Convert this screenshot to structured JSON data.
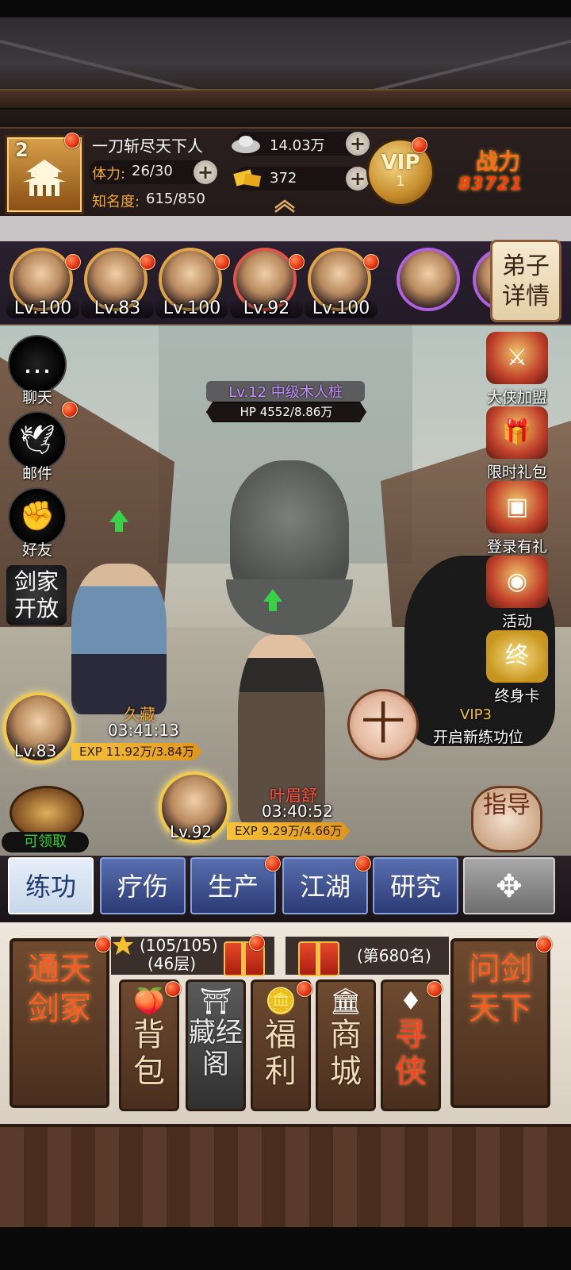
{
  "player": {
    "rank_level": "2",
    "name": "一刀斩尽天下人",
    "stamina_label": "体力:",
    "stamina_value": "26/30",
    "fame_label": "知名度:",
    "fame_value": "615/850",
    "silver": "14.03万",
    "gold": "372",
    "vip_text": "VIP",
    "vip_level": "1",
    "power_label": "战力",
    "power_value": "83721"
  },
  "disciples": [
    {
      "level": "Lv.100"
    },
    {
      "level": "Lv.83"
    },
    {
      "level": "Lv.100"
    },
    {
      "level": "Lv.92"
    },
    {
      "level": "Lv.100"
    }
  ],
  "disciple_detail_label": "弟子详情",
  "enemy": {
    "name": "Lv.12 中级木人桩",
    "hp": "HP 4552/8.86万"
  },
  "left_menu": [
    {
      "label": "聊天",
      "icon": "chat-bubble-icon"
    },
    {
      "label": "邮件",
      "icon": "dove-mail-icon"
    },
    {
      "label": "好友",
      "icon": "friends-fist-icon"
    }
  ],
  "jianjia_label": "剑家开放",
  "right_menu": [
    {
      "label": "大侠加盟",
      "icon": "hero-join-icon"
    },
    {
      "label": "限时礼包",
      "icon": "gift-pack-icon"
    },
    {
      "label": "登录有礼",
      "icon": "treasure-chest-icon"
    },
    {
      "label": "活动",
      "icon": "lantern-icon"
    },
    {
      "label": "终身卡",
      "icon": "lifetime-card-icon"
    }
  ],
  "cultivators": [
    {
      "name": "久藏",
      "timer": "03:41:13",
      "level": "Lv.83",
      "exp": "EXP 11.92万/3.84万"
    },
    {
      "name": "叶眉舒",
      "timer": "03:40:52",
      "level": "Lv.92",
      "exp": "EXP 9.29万/4.66万"
    }
  ],
  "add_slot_symbol": "十",
  "vip_slot": {
    "vip": "VIP3",
    "text": "开启新练功位"
  },
  "claim_label": "可领取",
  "guide_label": "指导",
  "tabs": [
    "练功",
    "疗伤",
    "生产",
    "江湖",
    "研究",
    "✥"
  ],
  "tower": {
    "line1": "(105/105)",
    "line2": "(46层)"
  },
  "rank_text": "(第680名)",
  "left_big_button": "通天剑冢",
  "right_big_button": "问剑天下",
  "small_buttons": [
    {
      "label": "背包",
      "icon": "peach-icon"
    },
    {
      "label": "藏经阁",
      "icon": "pavilion-icon"
    },
    {
      "label": "福利",
      "icon": "coin-icon"
    },
    {
      "label": "商城",
      "icon": "shop-icon"
    },
    {
      "label": "寻侠",
      "icon": "red-seal-icon"
    }
  ]
}
